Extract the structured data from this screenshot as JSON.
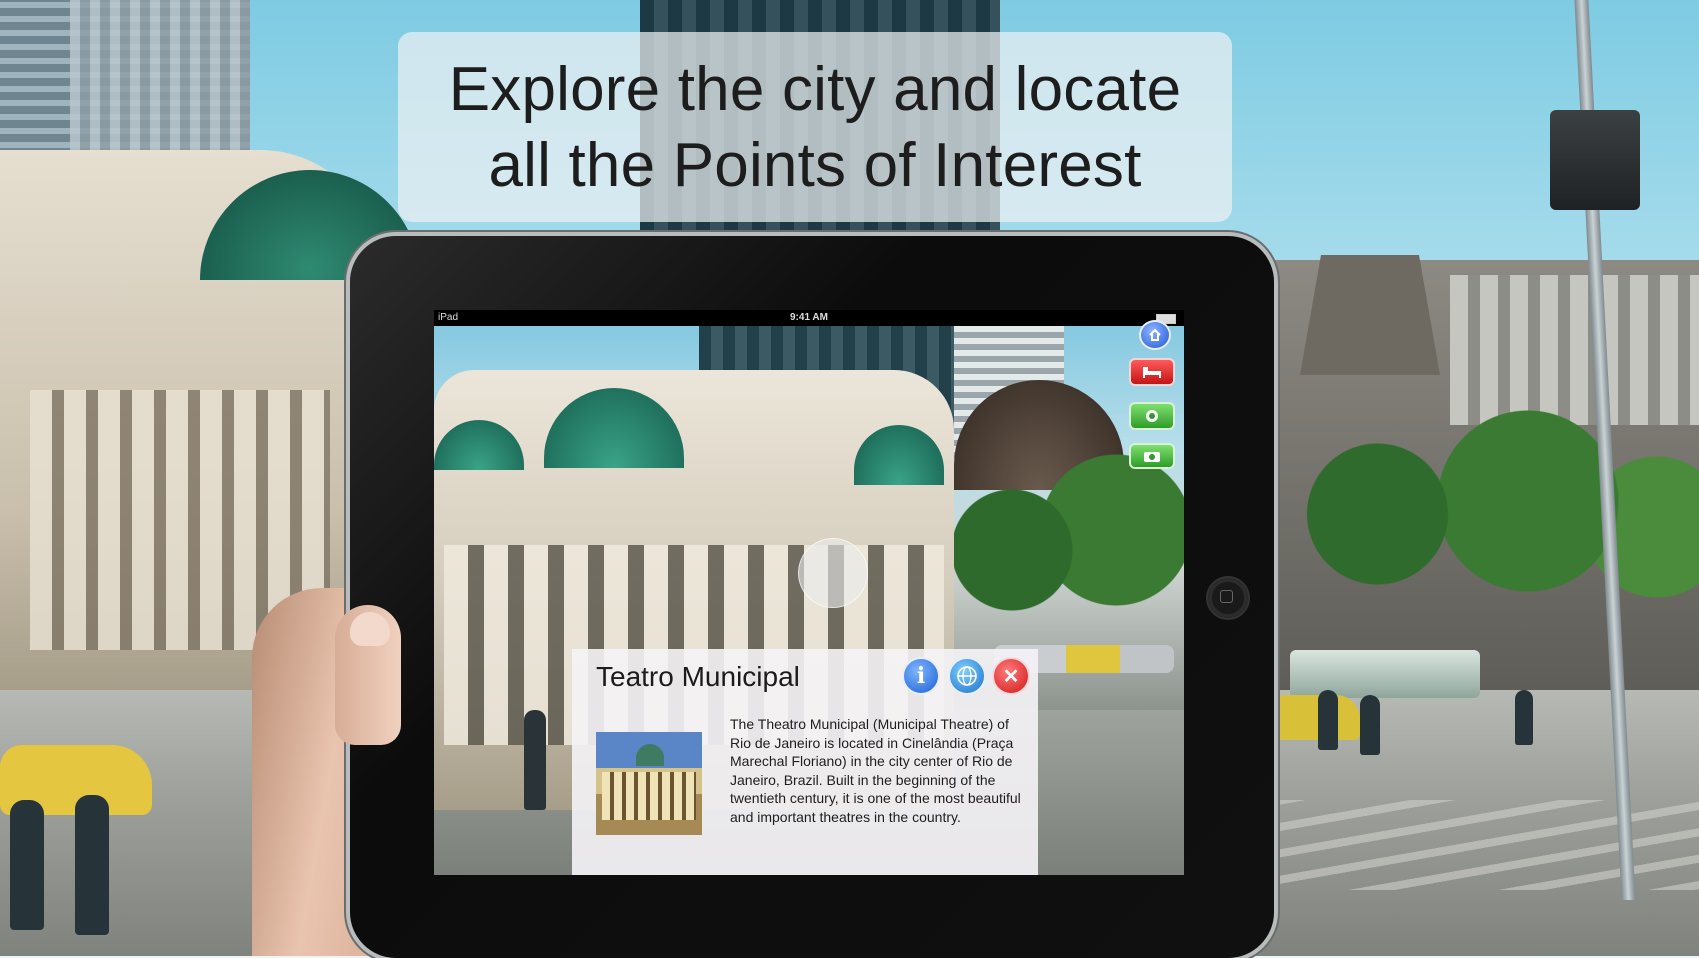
{
  "headline": {
    "line1": "Explore the city and locate",
    "line2": "all the Points of Interest"
  },
  "device": {
    "status_bar": {
      "carrier": "iPad",
      "time": "9:41 AM"
    }
  },
  "poi_toolbar": {
    "icons": [
      "home-icon",
      "hotel-bed-icon",
      "restaurant-icon",
      "camera-icon"
    ],
    "colors": {
      "home": "#1f59d6",
      "hotel": "#c41515",
      "food": "#2f9c2a",
      "photo": "#2f9c2a"
    }
  },
  "info_card": {
    "title": "Teatro Municipal",
    "buttons": [
      "info-icon",
      "globe-icon",
      "close-icon"
    ],
    "description": "The Theatro Municipal (Municipal Theatre) of Rio de Janeiro is located in Cinelândia (Praça Marechal Floriano) in the city center of Rio de Janeiro, Brazil. Built in the beginning of the twentieth century, it is one of the most beautiful and important theatres in the country."
  }
}
